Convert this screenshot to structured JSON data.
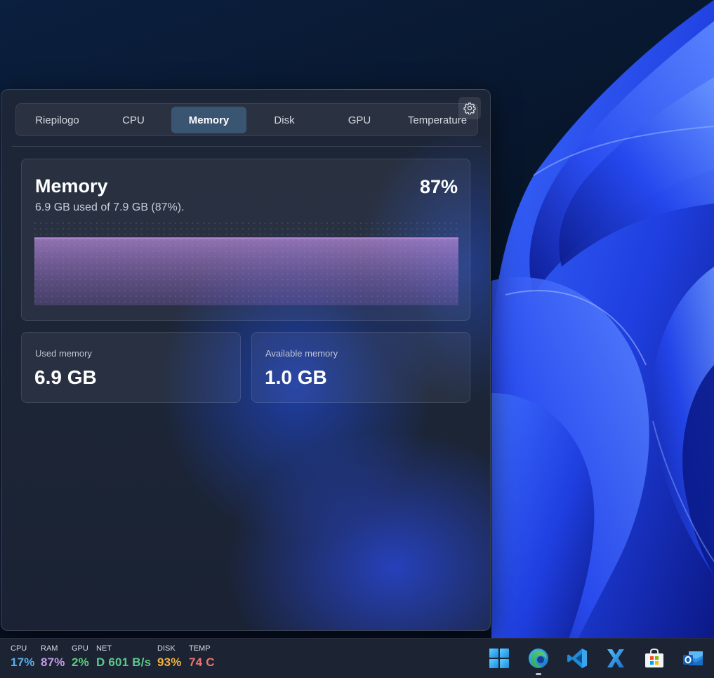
{
  "widget": {
    "tabs": [
      {
        "label": "Riepilogo",
        "active": false
      },
      {
        "label": "CPU",
        "active": false
      },
      {
        "label": "Memory",
        "active": true
      },
      {
        "label": "Disk",
        "active": false
      },
      {
        "label": "GPU",
        "active": false
      },
      {
        "label": "Temperature",
        "active": false
      }
    ],
    "settings_icon": "gear-icon",
    "memory": {
      "title": "Memory",
      "percent": "87%",
      "subtitle": "6.9 GB used of 7.9 GB (87%).",
      "usage_fraction": 0.87,
      "graph_color": "#b488d8"
    },
    "stats": {
      "used_label": "Used memory",
      "used_value": "6.9 GB",
      "available_label": "Available memory",
      "available_value": "1.0 GB"
    }
  },
  "taskbar": {
    "stats": [
      {
        "label": "CPU",
        "value": "17%",
        "color": "#5ab0f0"
      },
      {
        "label": "RAM",
        "value": "87%",
        "color": "#c59be6"
      },
      {
        "label": "GPU",
        "value": "2%",
        "color": "#5cd17a"
      },
      {
        "label": "NET",
        "value": "D 601 B/s",
        "color": "#5cc98c"
      },
      {
        "label": "DISK",
        "value": "93%",
        "color": "#f0b140"
      },
      {
        "label": "TEMP",
        "value": "74 C",
        "color": "#f07470"
      }
    ],
    "apps": [
      {
        "icon": "windows-start-icon"
      },
      {
        "icon": "edge-browser-icon",
        "active": true
      },
      {
        "icon": "vscode-icon"
      },
      {
        "icon": "app-x-icon"
      },
      {
        "icon": "microsoft-store-icon"
      },
      {
        "icon": "outlook-icon"
      }
    ]
  }
}
